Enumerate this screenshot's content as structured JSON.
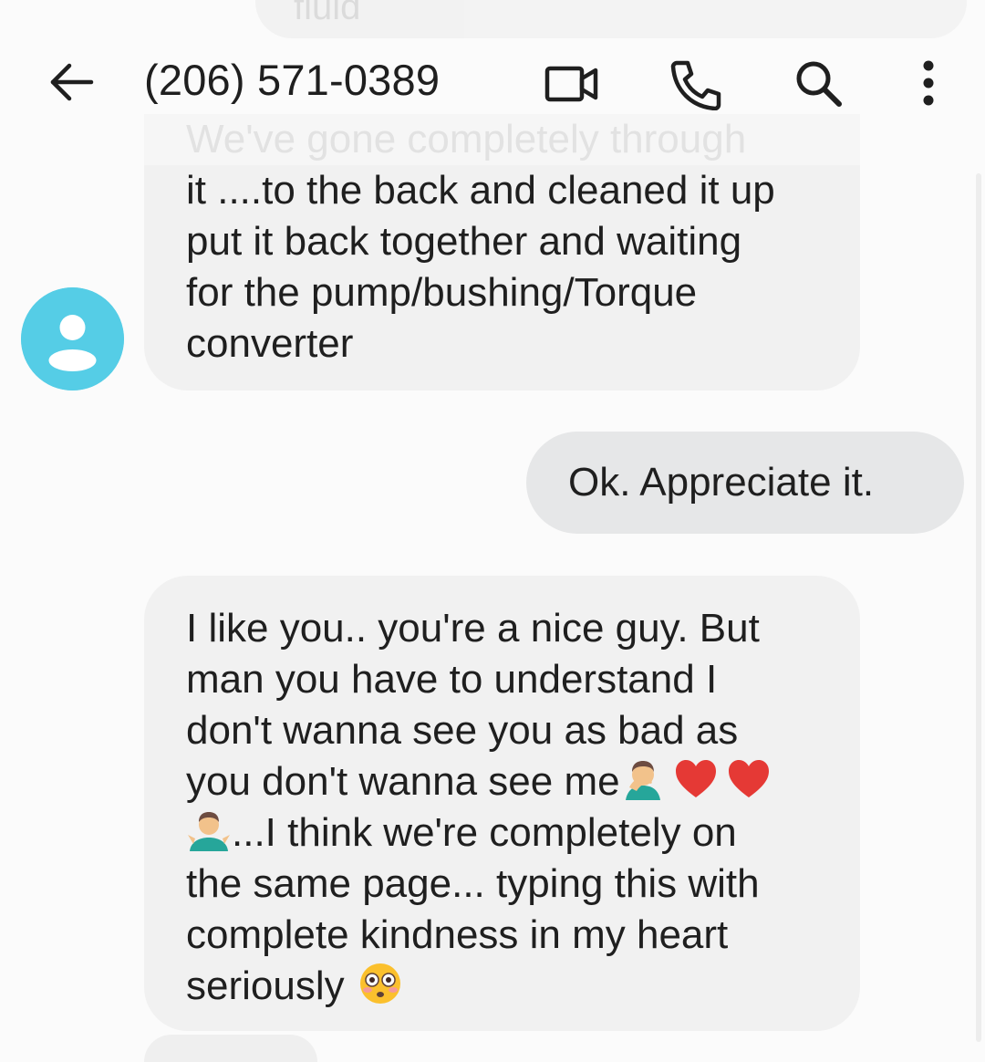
{
  "header": {
    "title": "(206) 571-0389",
    "back_icon": "arrow-back-icon",
    "actions": [
      {
        "name": "video-call-icon"
      },
      {
        "name": "phone-icon"
      },
      {
        "name": "search-icon"
      },
      {
        "name": "more-vert-icon"
      }
    ]
  },
  "messages": {
    "previous_fragment": "fluid",
    "incoming_1": {
      "faded_line": "We've gone completely through",
      "lines": [
        "it ....to the back and cleaned it up",
        "put it back together and waiting",
        "for the pump/bushing/Torque",
        "converter"
      ]
    },
    "outgoing_1": {
      "text": "Ok.  Appreciate it."
    },
    "incoming_2": {
      "lines": [
        "I like you.. you're a nice guy. But",
        "man you have to understand I",
        "don't wanna see you as bad as",
        "you don't wanna see me",
        "...I think we're completely on",
        "the same page... typing this with",
        "complete kindness in my heart",
        "seriously"
      ]
    }
  },
  "colors": {
    "avatar": "#55cde6",
    "incoming_bubble": "#f1f1f1",
    "outgoing_bubble": "#e6e7e8",
    "background": "#fbfbfb"
  }
}
